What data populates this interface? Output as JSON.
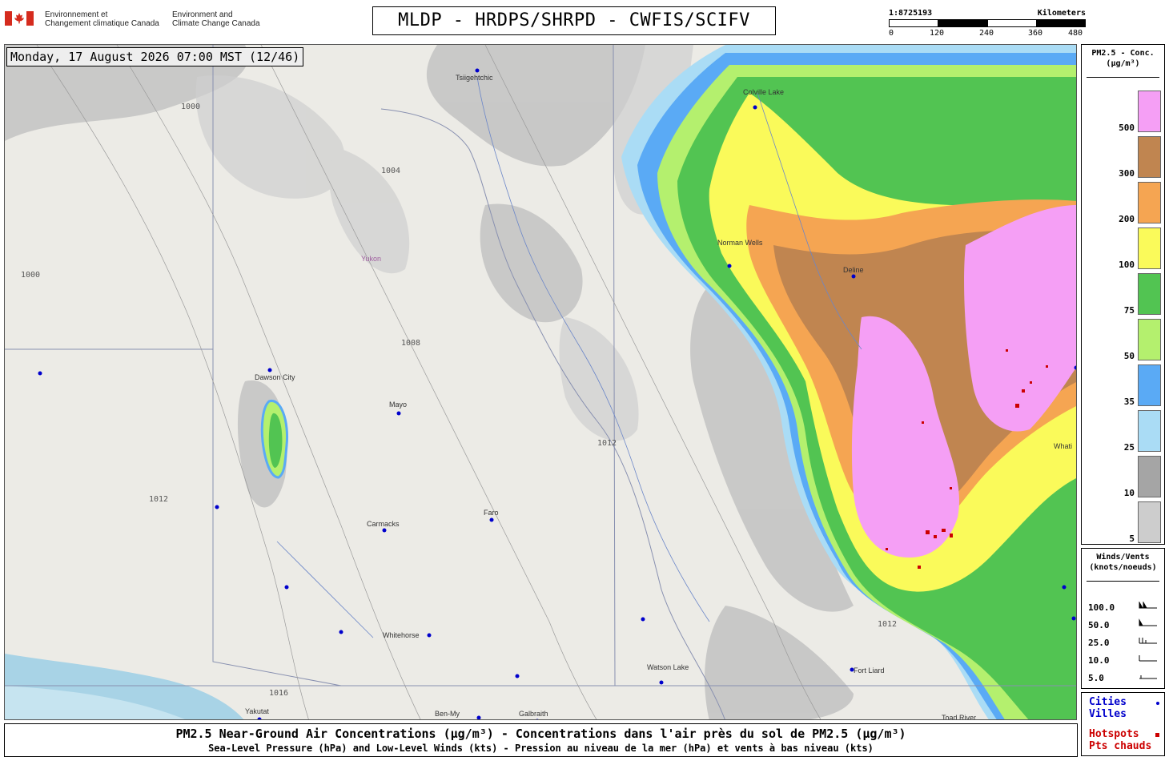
{
  "header": {
    "dept_fr": [
      "Environnement et",
      "Changement climatique Canada"
    ],
    "dept_en": [
      "Environment and",
      "Climate Change Canada"
    ],
    "title": "MLDP - HRDPS/SHRPD - CWFIS/SCIFV"
  },
  "scale_bar": {
    "ratio": "1:8725193",
    "unit": "Kilometers",
    "ticks": [
      "0",
      "120",
      "240",
      "360",
      "480"
    ]
  },
  "map": {
    "timestamp": "Monday, 17 August 2026 07:00 MST (12/46)",
    "region_labels": [
      "Yukon"
    ],
    "cities": [
      {
        "name": "Tsiigehtchic"
      },
      {
        "name": "Colville Lake"
      },
      {
        "name": "Norman Wells"
      },
      {
        "name": "Deline"
      },
      {
        "name": "Dawson City"
      },
      {
        "name": "Mayo"
      },
      {
        "name": "Carmacks"
      },
      {
        "name": "Faro"
      },
      {
        "name": "Whitehorse"
      },
      {
        "name": "Watson Lake"
      },
      {
        "name": "Fort Liard"
      },
      {
        "name": "Yakutat"
      },
      {
        "name": "Galbraith"
      },
      {
        "name": "Ben-My"
      },
      {
        "name": "Whati"
      },
      {
        "name": "Toad River"
      }
    ],
    "isobar_labels": [
      "1000",
      "1004",
      "1008",
      "1012",
      "1016"
    ]
  },
  "legend_pm25": {
    "title_line1": "PM2.5 - Conc.",
    "title_line2": "(µg/m³)",
    "levels": [
      {
        "label": "500",
        "color": "#f59ff5"
      },
      {
        "label": "300",
        "color": "#c08550"
      },
      {
        "label": "200",
        "color": "#f5a552"
      },
      {
        "label": "100",
        "color": "#fafa5a"
      },
      {
        "label": "75",
        "color": "#52c452"
      },
      {
        "label": "50",
        "color": "#b4f06e"
      },
      {
        "label": "35",
        "color": "#5aaaf5"
      },
      {
        "label": "25",
        "color": "#aadcf5"
      },
      {
        "label": "10",
        "color": "#a5a5a5"
      },
      {
        "label": "5",
        "color": "#cdcdcd"
      }
    ]
  },
  "legend_wind": {
    "title_line1": "Winds/Vents",
    "title_line2": "(knots/noeuds)",
    "rows": [
      "100.0",
      "50.0",
      "25.0",
      "10.0",
      "5.0"
    ]
  },
  "legend_points": {
    "cities_en": "Cities",
    "cities_fr": "Villes",
    "hotspots_en": "Hotspots",
    "hotspots_fr": "Pts chauds",
    "city_color": "#0000cc",
    "hotspot_color": "#cc0000"
  },
  "footer": {
    "line1": "PM2.5 Near-Ground Air Concentrations (µg/m³) - Concentrations dans l'air près du sol de PM2.5 (µg/m³)",
    "line2": "Sea-Level Pressure (hPa) and Low-Level Winds (kts) - Pression au niveau de la mer (hPa) et vents à bas niveau (kts)"
  }
}
